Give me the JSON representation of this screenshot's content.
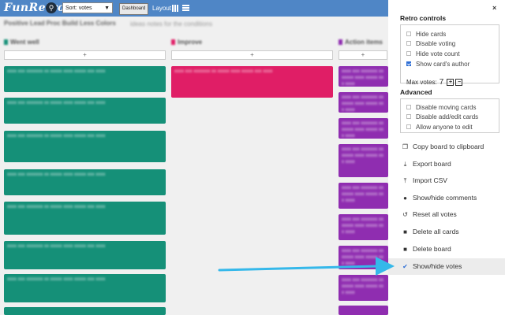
{
  "topbar": {
    "logo": "FunRetro",
    "sort_select": "Sort: votes",
    "dashboard_label": "Dashboard",
    "layout_label": "Layout"
  },
  "board": {
    "title": "Positive Lead Proc Build Less Colors",
    "subtitle": "ideas notes for the conditions",
    "columns": [
      {
        "label": "Went well",
        "color": "#159078"
      },
      {
        "label": "Improve",
        "color": "#e01e66"
      },
      {
        "label": "Action items",
        "color": "#8f2db0"
      }
    ],
    "add_glyph": "+",
    "card_text": "xxxx xxx xxxxxxx xx xxxxx xxxx xxxxx xxx xxxx"
  },
  "panel": {
    "close": "×",
    "retro_title": "Retro controls",
    "retro_options": [
      {
        "label": "Hide cards",
        "checked": false
      },
      {
        "label": "Disable voting",
        "checked": false
      },
      {
        "label": "Hide vote count",
        "checked": false
      },
      {
        "label": "Show card's author",
        "checked": true
      }
    ],
    "max_votes_label": "Max votes:",
    "max_votes_value": "7",
    "plus": "+",
    "minus": "−",
    "advanced_title": "Advanced",
    "advanced_options": [
      {
        "label": "Disable moving cards",
        "checked": false
      },
      {
        "label": "Disable add/edit cards",
        "checked": false
      },
      {
        "label": "Allow anyone to edit",
        "checked": false
      }
    ],
    "actions": [
      {
        "label": "Copy board to clipboard",
        "icon": "copy-icon",
        "glyph": "❐"
      },
      {
        "label": "Export board",
        "icon": "download-icon",
        "glyph": "⤓"
      },
      {
        "label": "Import CSV",
        "icon": "upload-icon",
        "glyph": "⤒"
      },
      {
        "label": "Show/hide comments",
        "icon": "comments-icon",
        "glyph": "●"
      },
      {
        "label": "Reset all votes",
        "icon": "undo-icon",
        "glyph": "↺"
      },
      {
        "label": "Delete all cards",
        "icon": "trash-icon",
        "glyph": "■"
      },
      {
        "label": "Delete board",
        "icon": "trash-icon",
        "glyph": "■"
      },
      {
        "label": "Show/hide votes",
        "icon": "check-icon",
        "glyph": "✔"
      }
    ]
  },
  "colors": {
    "topbar": "#4f86c6",
    "arrow": "#35b8ea",
    "accent": "#2f6fd6"
  }
}
